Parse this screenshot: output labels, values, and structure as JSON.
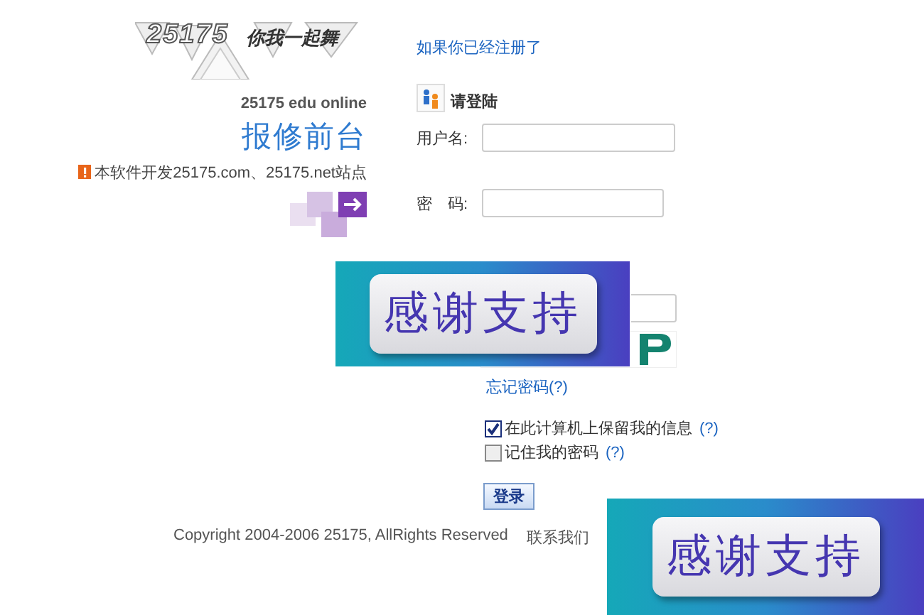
{
  "logo": {
    "brand": "25175",
    "slogan": "你我一起舞"
  },
  "site_subtitle": "25175 edu online",
  "page_title": "报修前台",
  "notice": "本软件开发25175.com、25175.net站点",
  "register_link": "如果你已经注册了",
  "login": {
    "heading": "请登陆",
    "username_label": "用户名:",
    "password_label": "密　码:",
    "forgot_link": "忘记密码(?)",
    "options": [
      {
        "label": "在此计算机上保留我的信息",
        "help": "(?)",
        "checked": true
      },
      {
        "label": "记住我的密码",
        "help": "(?)",
        "checked": false
      }
    ],
    "submit": "登录"
  },
  "footer": {
    "copyright": "Copyright 2004-2006 25175, AllRights Reserved",
    "contact": "联系我们"
  },
  "banners": [
    {
      "text": "感谢支持"
    },
    {
      "text": "感谢支持"
    }
  ]
}
